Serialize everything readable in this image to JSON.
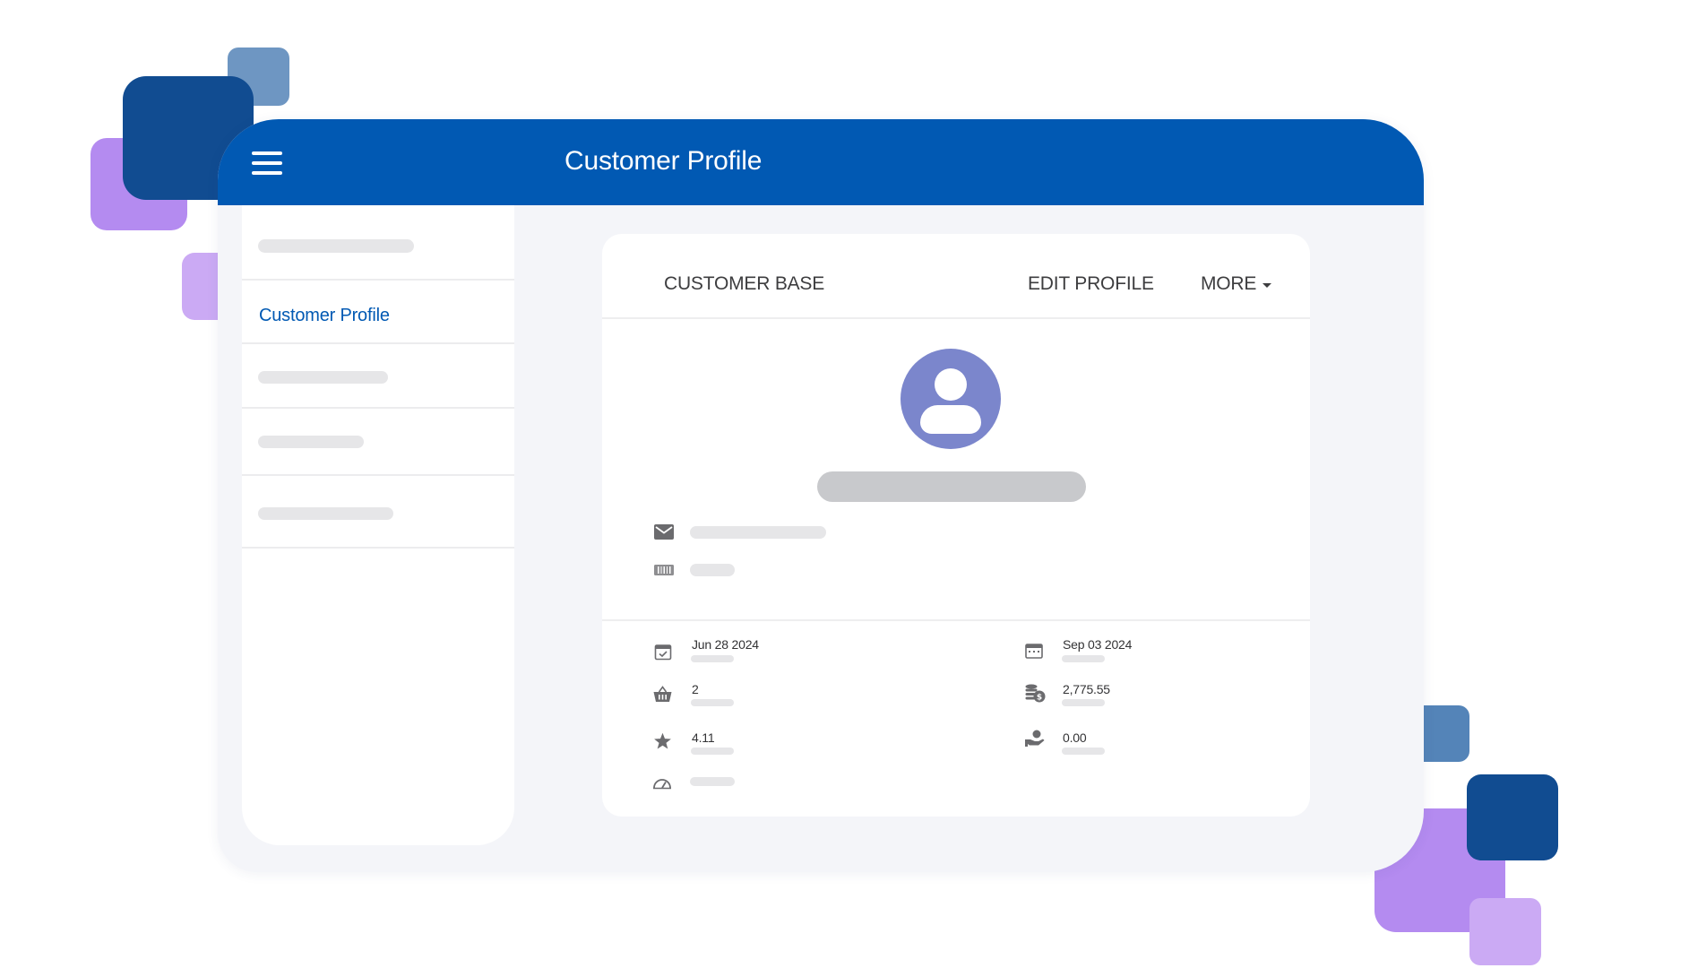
{
  "app_bar": {
    "title": "Customer Profile",
    "menu_icon": "hamburger-menu-icon",
    "color": "#0159b3"
  },
  "sidebar": {
    "active_item_label": "Customer Profile",
    "active_color": "#0159b3"
  },
  "card": {
    "tabs": {
      "customer_base": "CUSTOMER BASE",
      "edit_profile": "EDIT PROFILE",
      "more": "MORE"
    },
    "avatar_icon": "user-avatar-icon",
    "contact_icons": [
      "email-icon",
      "barcode-icon"
    ],
    "stats": {
      "date_first": "Jun 28 2024",
      "date_last": "Sep 03 2024",
      "orders": "2",
      "total_spent": "2,775.55",
      "rating": "4.11",
      "balance": "0.00"
    },
    "stat_icons": [
      "calendar-check-icon",
      "calendar-icon",
      "basket-icon",
      "coins-dollar-icon",
      "star-icon",
      "hand-coin-icon",
      "speedometer-icon"
    ]
  },
  "colors": {
    "avatar": "#7b86cc",
    "decor_dark_blue": "#114c91",
    "decor_steel_blue": "#6e96c2",
    "decor_purple": "#b48bf0",
    "decor_lavender": "#cbaaf4"
  }
}
